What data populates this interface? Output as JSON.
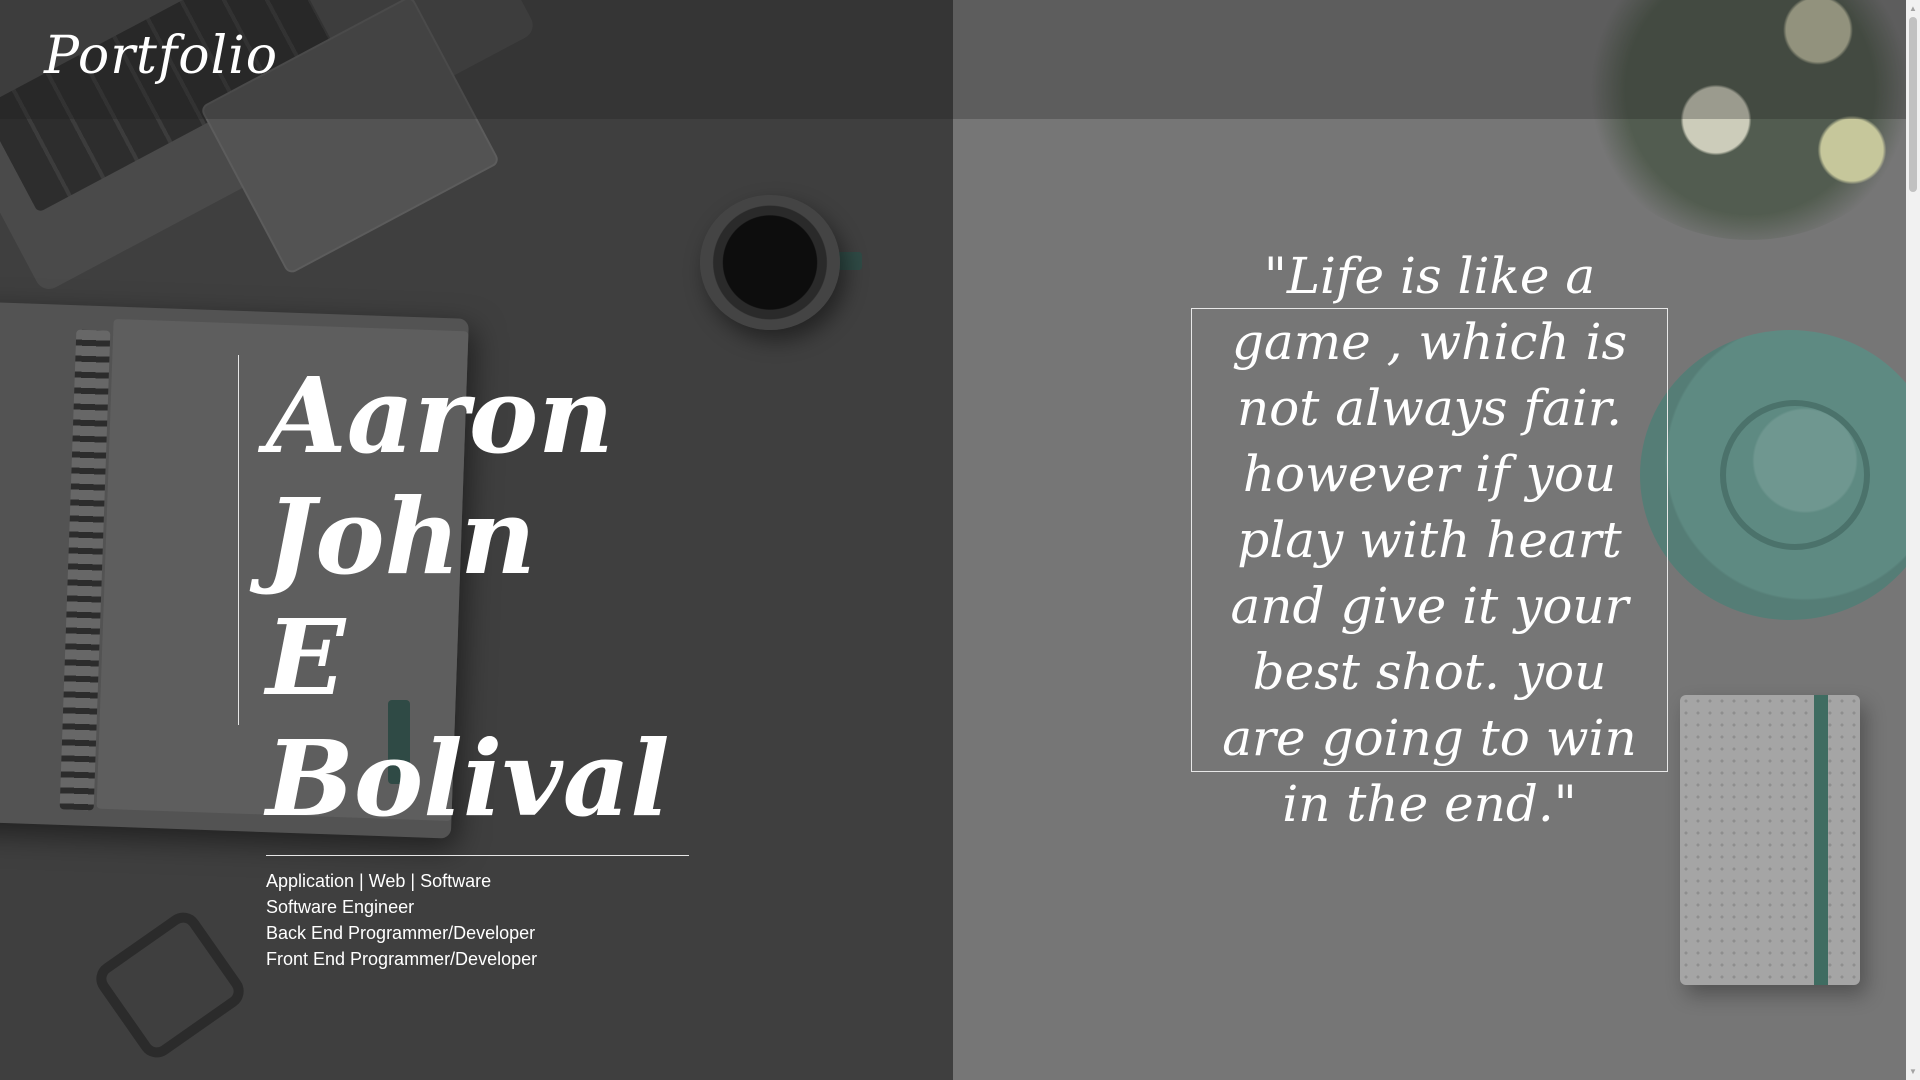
{
  "header": {
    "brand": "Portfolio"
  },
  "intro": {
    "name_line1": "Aaron John",
    "name_line2": "E Bolival",
    "roles": [
      "Application | Web | Software",
      "Software Engineer",
      "Back End Programmer/Developer",
      "Front End Programmer/Developer"
    ]
  },
  "quote": {
    "text": "\"Life is like a game , which is not always fair. however if you play with heart and give it your best shot. you are going to win in the end.\""
  },
  "colors": {
    "left_bg": "#3f3f3f",
    "right_bg": "#767676",
    "accent_green": "#2f4a45",
    "text": "#ffffff"
  },
  "scrollbar": {
    "up_icon": "chevron-up-icon",
    "down_icon": "chevron-down-icon"
  }
}
